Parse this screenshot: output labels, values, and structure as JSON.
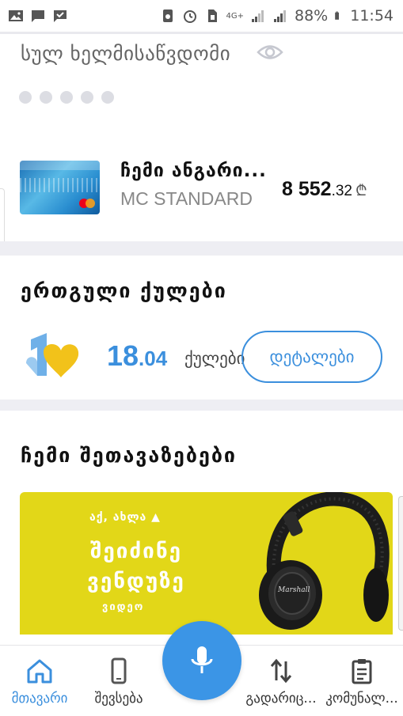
{
  "status_bar": {
    "battery_percent": "88%",
    "time": "11:54",
    "network_label": "4G+",
    "icons": [
      "gallery-icon",
      "message-icon",
      "check-message-icon",
      "recycle-icon",
      "alarm-icon",
      "sim-icon",
      "signal-icon",
      "signal-icon",
      "battery-icon"
    ]
  },
  "available": {
    "title": "სულ ხელმისაწვდომი",
    "hidden_dots": 5
  },
  "card": {
    "name": "ჩემი ანგარი...",
    "type": "MC STANDARD",
    "amount_int": "8 552",
    "amount_dec": ".32",
    "currency": "₾"
  },
  "loyalty": {
    "title": "ერთგული ქულები",
    "points_int": "18",
    "points_dec": ".04",
    "unit": "ქულები",
    "details_button": "დეტალები"
  },
  "offers": {
    "title": "ჩემი შეთავაზებები",
    "banner_tag": "აქ, ახლა",
    "banner_head_line1": "შეიძინე",
    "banner_head_line2": "ვენდუზე",
    "banner_sub": "ვიდეო"
  },
  "bottom_nav": {
    "items": [
      {
        "label": "მთავარი",
        "icon": "home-icon",
        "active": true
      },
      {
        "label": "შევსება",
        "icon": "phone-icon",
        "active": false
      },
      {
        "label": "გადარიც...",
        "icon": "transfer-icon",
        "active": false
      },
      {
        "label": "კომუნალ...",
        "icon": "clipboard-icon",
        "active": false
      }
    ],
    "fab_icon": "microphone-icon"
  },
  "colors": {
    "accent": "#3b8fdd",
    "banner_yellow": "#e2d718",
    "divider": "#eeeef3"
  }
}
